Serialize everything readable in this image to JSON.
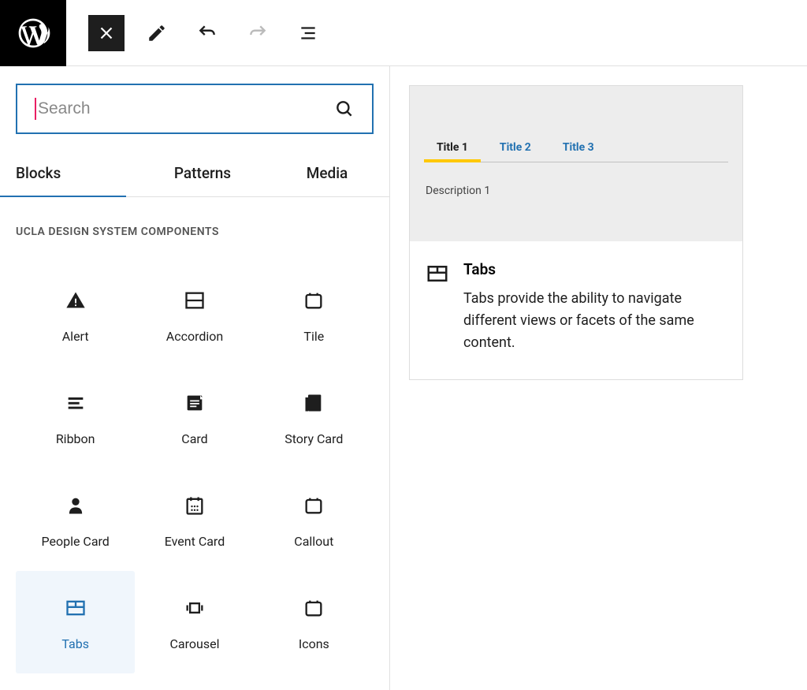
{
  "search": {
    "placeholder": "Search"
  },
  "tabs": {
    "blocks": "Blocks",
    "patterns": "Patterns",
    "media": "Media"
  },
  "category": {
    "title": "UCLA DESIGN SYSTEM COMPONENTS"
  },
  "blocks": [
    {
      "label": "Alert"
    },
    {
      "label": "Accordion"
    },
    {
      "label": "Tile"
    },
    {
      "label": "Ribbon"
    },
    {
      "label": "Card"
    },
    {
      "label": "Story Card"
    },
    {
      "label": "People Card"
    },
    {
      "label": "Event Card"
    },
    {
      "label": "Callout"
    },
    {
      "label": "Tabs"
    },
    {
      "label": "Carousel"
    },
    {
      "label": "Icons"
    }
  ],
  "preview": {
    "tabs": [
      "Title 1",
      "Title 2",
      "Title 3"
    ],
    "description": "Description 1",
    "info_title": "Tabs",
    "info_text": "Tabs provide the ability to navigate different views or facets of the same content."
  }
}
